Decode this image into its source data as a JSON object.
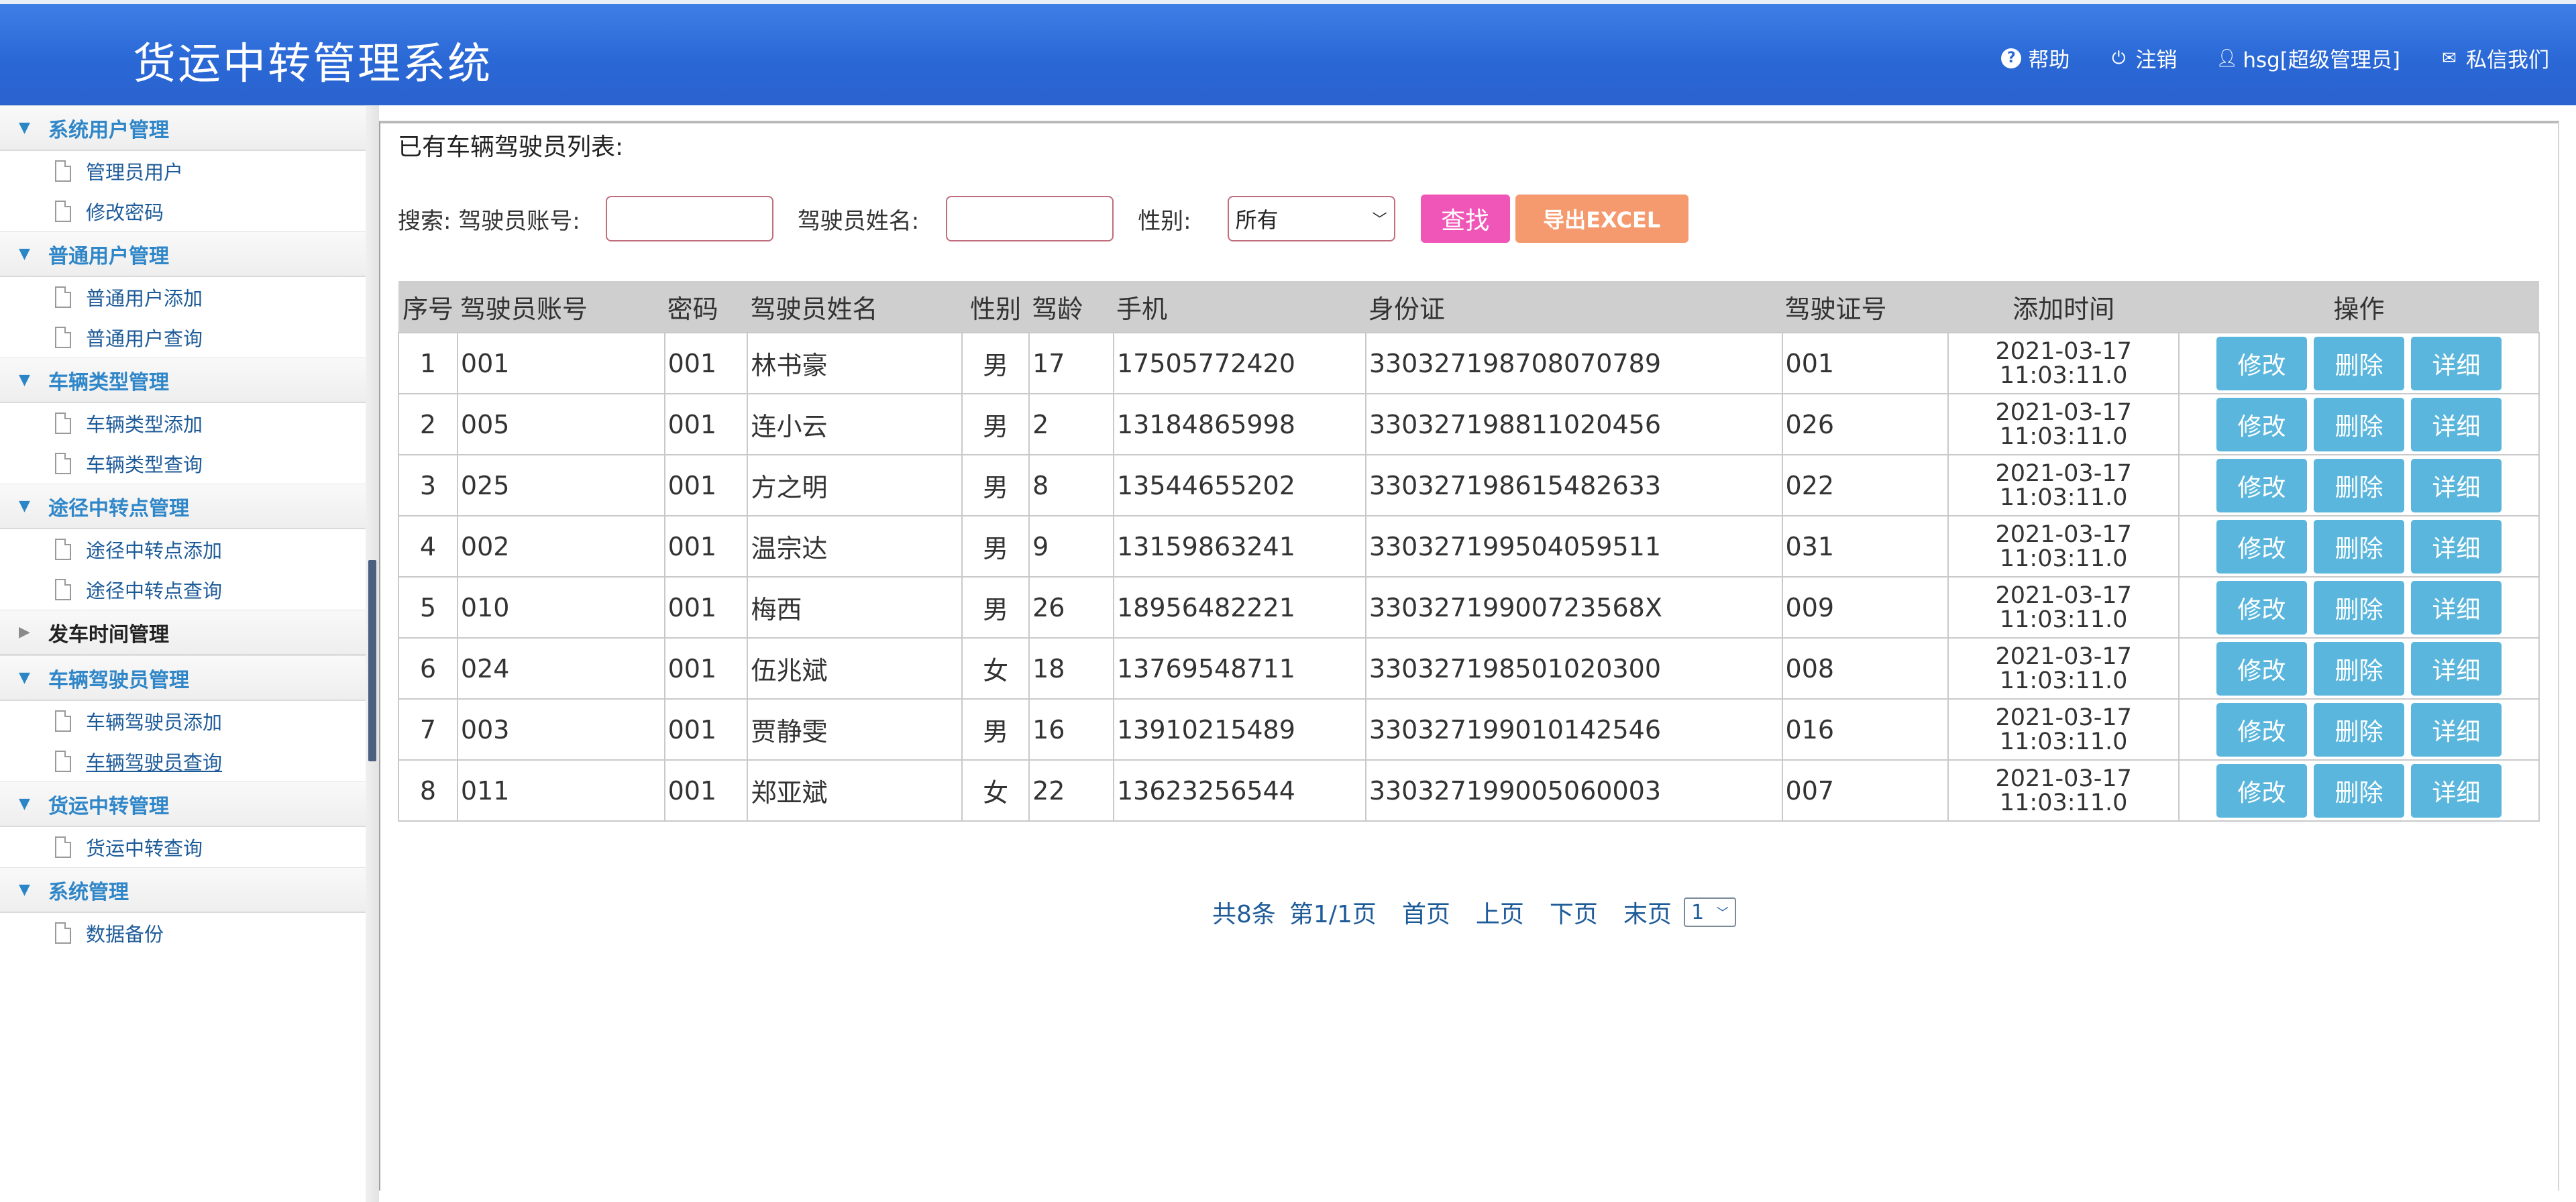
{
  "header": {
    "title": "货运中转管理系统",
    "links": [
      {
        "icon": "help-icon",
        "label": "帮助"
      },
      {
        "icon": "power-icon",
        "label": "注销"
      },
      {
        "icon": "user-icon",
        "label": "hsg[超级管理员]"
      },
      {
        "icon": "mail-icon",
        "label": "私信我们"
      }
    ]
  },
  "sidebar": {
    "groups": [
      {
        "label": "系统用户管理",
        "items": [
          "管理员用户",
          "修改密码"
        ]
      },
      {
        "label": "普通用户管理",
        "items": [
          "普通用户添加",
          "普通用户查询"
        ]
      },
      {
        "label": "车辆类型管理",
        "items": [
          "车辆类型添加",
          "车辆类型查询"
        ]
      },
      {
        "label": "途径中转点管理",
        "items": [
          "途径中转点添加",
          "途径中转点查询"
        ]
      },
      {
        "label": "发车时间管理",
        "items": []
      },
      {
        "label": "车辆驾驶员管理",
        "items": [
          "车辆驾驶员添加",
          "车辆驾驶员查询"
        ]
      },
      {
        "label": "货运中转管理",
        "items": [
          "货运中转查询"
        ]
      },
      {
        "label": "系统管理",
        "items": [
          "数据备份"
        ]
      }
    ]
  },
  "main": {
    "caption": "已有车辆驾驶员列表:",
    "search": {
      "prefix": "搜索: 驾驶员账号:",
      "name_label": "驾驶员姓名:",
      "gender_label": "性别:",
      "gender_value": "所有",
      "find_button": "查找",
      "export_button": "导出EXCEL"
    },
    "table": {
      "headers": [
        "序号",
        "驾驶员账号",
        "密码",
        "驾驶员姓名",
        "性别",
        "驾龄",
        "手机",
        "身份证",
        "驾驶证号",
        "添加时间",
        "操作"
      ],
      "rows": [
        [
          "1",
          "001",
          "001",
          "林书豪",
          "男",
          "17",
          "17505772420",
          "330327198708070789",
          "001",
          "2021-03-17",
          "11:03:11.0"
        ],
        [
          "2",
          "005",
          "001",
          "连小云",
          "男",
          "2",
          "13184865998",
          "330327198811020456",
          "026",
          "2021-03-17",
          "11:03:11.0"
        ],
        [
          "3",
          "025",
          "001",
          "方之明",
          "男",
          "8",
          "13544655202",
          "330327198615482633",
          "022",
          "2021-03-17",
          "11:03:11.0"
        ],
        [
          "4",
          "002",
          "001",
          "温宗达",
          "男",
          "9",
          "13159863241",
          "330327199504059511",
          "031",
          "2021-03-17",
          "11:03:11.0"
        ],
        [
          "5",
          "010",
          "001",
          "梅西",
          "男",
          "26",
          "18956482221",
          "33032719900723568X",
          "009",
          "2021-03-17",
          "11:03:11.0"
        ],
        [
          "6",
          "024",
          "001",
          "伍兆斌",
          "女",
          "18",
          "13769548711",
          "330327198501020300",
          "008",
          "2021-03-17",
          "11:03:11.0"
        ],
        [
          "7",
          "003",
          "001",
          "贾静雯",
          "男",
          "16",
          "13910215489",
          "330327199010142546",
          "016",
          "2021-03-17",
          "11:03:11.0"
        ],
        [
          "8",
          "011",
          "001",
          "郑亚斌",
          "女",
          "22",
          "13623256544",
          "330327199005060003",
          "007",
          "2021-03-17",
          "11:03:11.0"
        ]
      ],
      "ops": {
        "edit": "修改",
        "delete": "删除",
        "detail": "详细"
      }
    },
    "pager": {
      "summary": "共8条",
      "page_info": "第1/1页",
      "first": "首页",
      "prev": "上页",
      "next": "下页",
      "last": "末页",
      "page_select": "1"
    }
  }
}
